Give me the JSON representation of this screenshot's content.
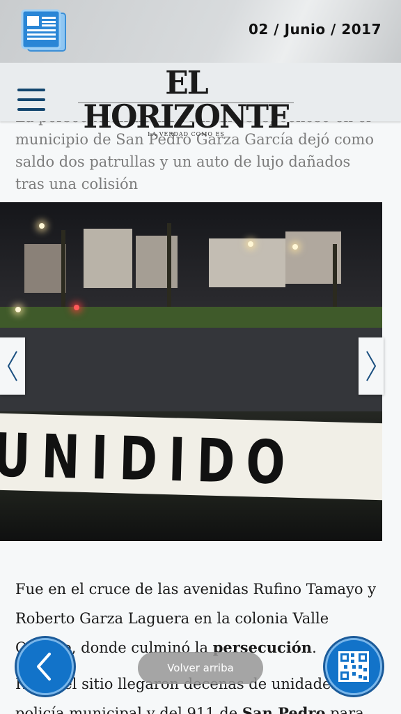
{
  "header": {
    "date": "02 / Junio / 2017",
    "logo_title": "EL HORIZONTE",
    "logo_tagline": "LA VERDAD COMO ES"
  },
  "article": {
    "lead": "La persecución de un vehículo sospechoso en el municipio de San Pedro Garza García dejó como saldo dos patrullas y un auto de lujo dañados tras una colisión",
    "photo_tape_text": "UNIDIDO",
    "para1_part1": "Fue en el cruce de las avenidas Rufino Tamayo y Roberto Garza Laguera en la colonia Valle Oriente, donde culminó la ",
    "para1_bold": "persecución",
    "para1_end": ".",
    "para2_part1": "Hasta el sitio llegaron decenas de unidades de policía municipal y del 911 de ",
    "para2_bold": "San Pedro",
    "para2_part2": " para"
  },
  "controls": {
    "back_to_top": "Volver arriba"
  },
  "icons": {
    "news": "newspaper-icon",
    "menu": "hamburger-menu-icon",
    "prev": "chevron-left-icon",
    "next": "chevron-right-icon",
    "back": "back-circle-icon",
    "qr": "qr-code-icon"
  },
  "colors": {
    "accent": "#1273c9",
    "menu": "#13466e"
  }
}
